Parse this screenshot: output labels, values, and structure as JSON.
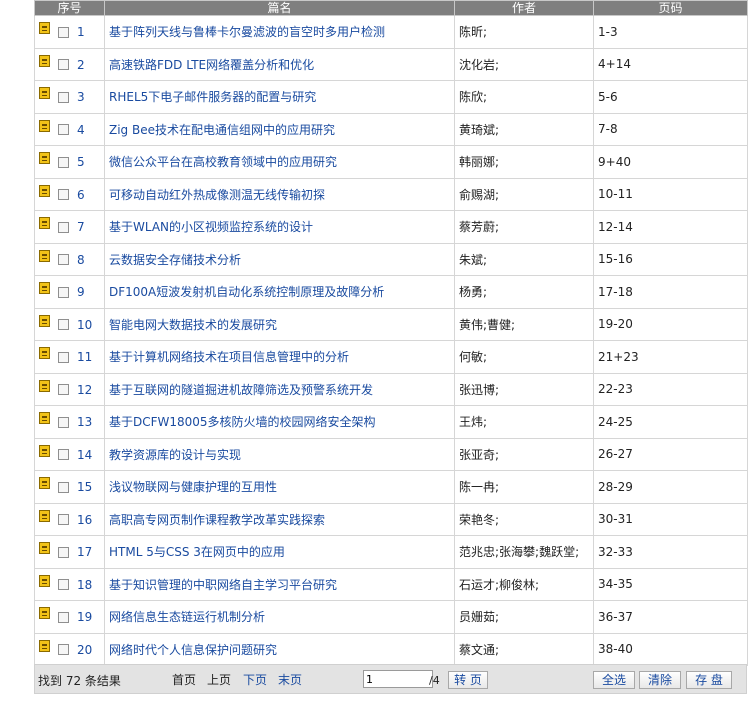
{
  "table": {
    "headers": [
      "序号",
      "篇名",
      "作者",
      "页码"
    ],
    "rows": [
      {
        "num": "1",
        "title": "基于阵列天线与鲁棒卡尔曼滤波的盲空时多用户检测",
        "author": "陈昕;",
        "pages": "1-3"
      },
      {
        "num": "2",
        "title": "高速铁路FDD LTE网络覆盖分析和优化",
        "author": "沈化岩;",
        "pages": "4+14"
      },
      {
        "num": "3",
        "title": "RHEL5下电子邮件服务器的配置与研究",
        "author": "陈欣;",
        "pages": "5-6"
      },
      {
        "num": "4",
        "title": "Zig Bee技术在配电通信组网中的应用研究",
        "author": "黄琦斌;",
        "pages": "7-8"
      },
      {
        "num": "5",
        "title": "微信公众平台在高校教育领域中的应用研究",
        "author": "韩丽娜;",
        "pages": "9+40"
      },
      {
        "num": "6",
        "title": "可移动自动红外热成像测温无线传输初探",
        "author": "俞赐湖;",
        "pages": "10-11"
      },
      {
        "num": "7",
        "title": "基于WLAN的小区视频监控系统的设计",
        "author": "蔡芳蔚;",
        "pages": "12-14"
      },
      {
        "num": "8",
        "title": "云数据安全存储技术分析",
        "author": "朱斌;",
        "pages": "15-16"
      },
      {
        "num": "9",
        "title": "DF100A短波发射机自动化系统控制原理及故障分析",
        "author": "杨勇;",
        "pages": "17-18"
      },
      {
        "num": "10",
        "title": "智能电网大数据技术的发展研究",
        "author": "黄伟;曹健;",
        "pages": "19-20"
      },
      {
        "num": "11",
        "title": "基于计算机网络技术在项目信息管理中的分析",
        "author": "何敏;",
        "pages": "21+23"
      },
      {
        "num": "12",
        "title": "基于互联网的隧道掘进机故障筛选及预警系统开发",
        "author": "张迅博;",
        "pages": "22-23"
      },
      {
        "num": "13",
        "title": "基于DCFW18005多核防火墙的校园网络安全架构",
        "author": "王炜;",
        "pages": "24-25"
      },
      {
        "num": "14",
        "title": "教学资源库的设计与实现",
        "author": "张亚奇;",
        "pages": "26-27"
      },
      {
        "num": "15",
        "title": "浅议物联网与健康护理的互用性",
        "author": "陈一冉;",
        "pages": "28-29"
      },
      {
        "num": "16",
        "title": "高职高专网页制作课程教学改革实践探索",
        "author": "荣艳冬;",
        "pages": "30-31"
      },
      {
        "num": "17",
        "title": "HTML 5与CSS 3在网页中的应用",
        "author": "范兆忠;张海攀;魏跃堂;",
        "pages": "32-33"
      },
      {
        "num": "18",
        "title": "基于知识管理的中职网络自主学习平台研究",
        "author": "石运才;柳俊林;",
        "pages": "34-35"
      },
      {
        "num": "19",
        "title": "网络信息生态链运行机制分析",
        "author": "员姗茹;",
        "pages": "36-37"
      },
      {
        "num": "20",
        "title": "网络时代个人信息保护问题研究",
        "author": "蔡文通;",
        "pages": "38-40"
      }
    ]
  },
  "footer": {
    "found": "找到 72 条结果",
    "first": "首页",
    "prev": "上页",
    "next": "下页",
    "last": "末页",
    "page_value": "1",
    "page_total": "/4",
    "go": "转 页",
    "select_all": "全选",
    "clear": "清除",
    "save": "存 盘"
  },
  "colors": {
    "header_bg": "#7f7f7f",
    "link": "#1a4ba0",
    "footer_bg": "#e3e3e3",
    "mark": "#f2c318"
  },
  "icons": {
    "row_mark": "document-icon",
    "row_select": "checkbox"
  }
}
